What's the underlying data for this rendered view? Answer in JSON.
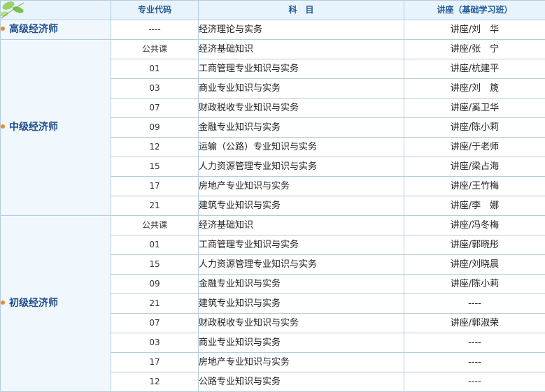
{
  "header": {
    "col_code": "专业代码",
    "col_subject": "科　目",
    "col_lecture": "讲座（基础学习班）"
  },
  "groups": [
    {
      "level": "高级经济师",
      "rows": [
        {
          "code": "----",
          "subject": "经济理论与实务",
          "lecture": "讲座/刘　华"
        }
      ]
    },
    {
      "level": "中级经济师",
      "rows": [
        {
          "code": "公共课",
          "subject": "经济基础知识",
          "lecture": "讲座/张　宁"
        },
        {
          "code": "01",
          "subject": "工商管理专业知识与实务",
          "lecture": "讲座/杭建平"
        },
        {
          "code": "03",
          "subject": "商业专业知识与实务",
          "lecture": "讲座/刘　篪"
        },
        {
          "code": "07",
          "subject": "财政税收专业知识与实务",
          "lecture": "讲座/奚卫华"
        },
        {
          "code": "09",
          "subject": "金融专业知识与实务",
          "lecture": "讲座/陈小莉"
        },
        {
          "code": "12",
          "subject": "运输（公路）专业知识与实务",
          "lecture": "讲座/于老师"
        },
        {
          "code": "15",
          "subject": "人力资源管理专业知识与实务",
          "lecture": "讲座/梁占海"
        },
        {
          "code": "17",
          "subject": "房地产专业知识与实务",
          "lecture": "讲座/王竹梅"
        },
        {
          "code": "21",
          "subject": "建筑专业知识与实务",
          "lecture": "讲座/李　娜"
        }
      ]
    },
    {
      "level": "初级经济师",
      "rows": [
        {
          "code": "公共课",
          "subject": "经济基础知识",
          "lecture": "讲座/冯冬梅"
        },
        {
          "code": "01",
          "subject": "工商管理专业知识与实务",
          "lecture": "讲座/郭晓彤"
        },
        {
          "code": "15",
          "subject": "人力资源管理专业知识与实务",
          "lecture": "讲座/刘晓晨"
        },
        {
          "code": "09",
          "subject": "金融专业知识与实务",
          "lecture": "讲座/陈小莉"
        },
        {
          "code": "21",
          "subject": "建筑专业知识与实务",
          "lecture": "----"
        },
        {
          "code": "07",
          "subject": "财政税收专业知识与实务",
          "lecture": "讲座/郭淑荣"
        },
        {
          "code": "03",
          "subject": "商业专业知识与实务",
          "lecture": "----"
        },
        {
          "code": "17",
          "subject": "房地产专业知识与实务",
          "lecture": "----"
        },
        {
          "code": "12",
          "subject": "公路专业知识与实务",
          "lecture": "----"
        }
      ]
    }
  ]
}
